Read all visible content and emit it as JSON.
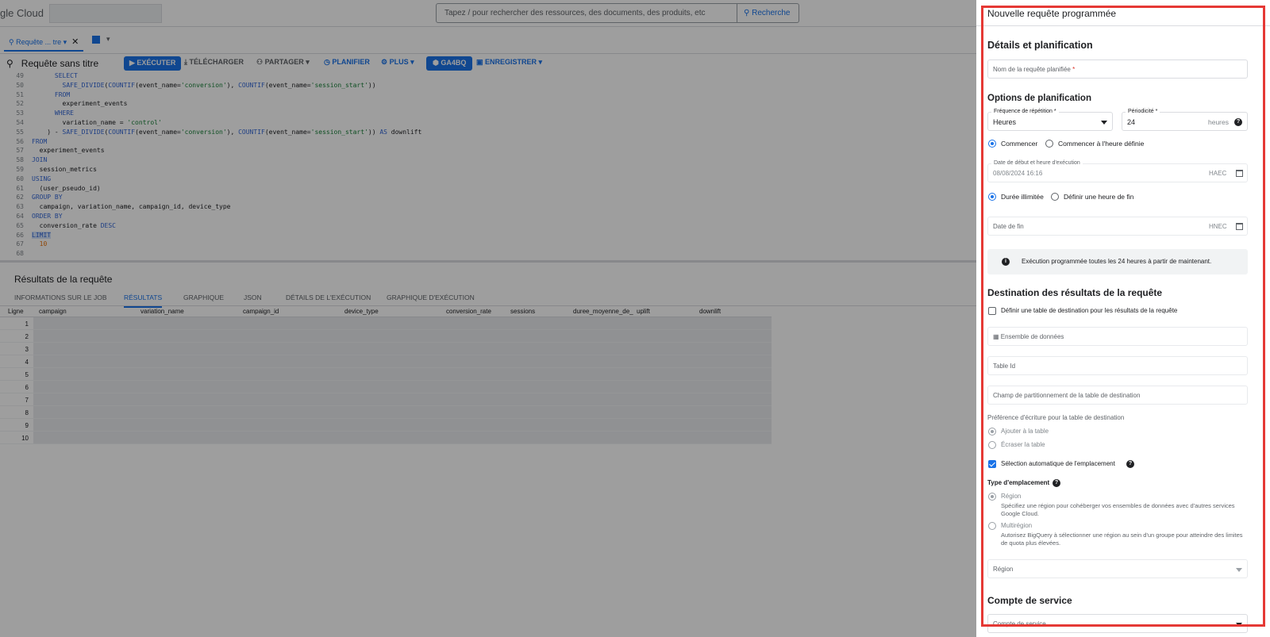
{
  "app": {
    "logo": "gle Cloud"
  },
  "search": {
    "placeholder": "Tapez / pour rechercher des ressources, des documents, des produits, etc",
    "button": "Recherche"
  },
  "editor_tab": {
    "label": "Requête ... tre"
  },
  "toolbar": {
    "title": "Requête sans titre",
    "run": "EXÉCUTER",
    "download": "TÉLÉCHARGER",
    "share": "PARTAGER",
    "schedule": "PLANIFIER",
    "more": "PLUS",
    "ga4": "GA4BQ",
    "save": "ENREGISTRER"
  },
  "code": [
    {
      "n": "49",
      "parts": [
        {
          "t": "      "
        },
        {
          "t": "SELECT",
          "c": "kw"
        }
      ]
    },
    {
      "n": "50",
      "parts": [
        {
          "t": "        "
        },
        {
          "t": "SAFE_DIVIDE",
          "c": "kw"
        },
        {
          "t": "("
        },
        {
          "t": "COUNTIF",
          "c": "kw"
        },
        {
          "t": "(event_name="
        },
        {
          "t": "'conversion'",
          "c": "str"
        },
        {
          "t": "), "
        },
        {
          "t": "COUNTIF",
          "c": "kw"
        },
        {
          "t": "(event_name="
        },
        {
          "t": "'session_start'",
          "c": "str"
        },
        {
          "t": "))"
        }
      ]
    },
    {
      "n": "51",
      "parts": [
        {
          "t": "      "
        },
        {
          "t": "FROM",
          "c": "kw"
        }
      ]
    },
    {
      "n": "52",
      "parts": [
        {
          "t": "        experiment_events"
        }
      ]
    },
    {
      "n": "53",
      "parts": [
        {
          "t": "      "
        },
        {
          "t": "WHERE",
          "c": "kw"
        }
      ]
    },
    {
      "n": "54",
      "parts": [
        {
          "t": "        variation_name = "
        },
        {
          "t": "'control'",
          "c": "str"
        }
      ]
    },
    {
      "n": "55",
      "parts": [
        {
          "t": "    ) - "
        },
        {
          "t": "SAFE_DIVIDE",
          "c": "kw"
        },
        {
          "t": "("
        },
        {
          "t": "COUNTIF",
          "c": "kw"
        },
        {
          "t": "(event_name="
        },
        {
          "t": "'conversion'",
          "c": "str"
        },
        {
          "t": "), "
        },
        {
          "t": "COUNTIF",
          "c": "kw"
        },
        {
          "t": "(event_name="
        },
        {
          "t": "'session_start'",
          "c": "str"
        },
        {
          "t": ")) "
        },
        {
          "t": "AS",
          "c": "kw"
        },
        {
          "t": " downlift"
        }
      ]
    },
    {
      "n": "56",
      "parts": [
        {
          "t": "FROM",
          "c": "kw"
        }
      ]
    },
    {
      "n": "57",
      "parts": [
        {
          "t": "  experiment_events"
        }
      ]
    },
    {
      "n": "58",
      "parts": [
        {
          "t": "JOIN",
          "c": "kw"
        }
      ]
    },
    {
      "n": "59",
      "parts": [
        {
          "t": "  session_metrics"
        }
      ]
    },
    {
      "n": "60",
      "parts": [
        {
          "t": "USING",
          "c": "kw"
        }
      ]
    },
    {
      "n": "61",
      "parts": [
        {
          "t": "  (user_pseudo_id)"
        }
      ]
    },
    {
      "n": "62",
      "parts": [
        {
          "t": "GROUP BY",
          "c": "kw"
        }
      ]
    },
    {
      "n": "63",
      "parts": [
        {
          "t": "  campaign, variation_name, campaign_id, device_type"
        }
      ]
    },
    {
      "n": "64",
      "parts": [
        {
          "t": "ORDER BY",
          "c": "kw"
        }
      ]
    },
    {
      "n": "65",
      "parts": [
        {
          "t": "  conversion_rate "
        },
        {
          "t": "DESC",
          "c": "kw"
        }
      ]
    },
    {
      "n": "66",
      "parts": [
        {
          "t": "LIMIT",
          "c": "kw hl"
        }
      ]
    },
    {
      "n": "67",
      "parts": [
        {
          "t": "  "
        },
        {
          "t": "10",
          "c": "num"
        }
      ]
    },
    {
      "n": "68",
      "parts": [
        {
          "t": ""
        }
      ]
    }
  ],
  "results": {
    "title": "Résultats de la requête",
    "tabs": [
      "INFORMATIONS SUR LE JOB",
      "RÉSULTATS",
      "GRAPHIQUE",
      "JSON",
      "DÉTAILS DE L'EXÉCUTION",
      "GRAPHIQUE D'EXÉCUTION"
    ],
    "active_tab": "RÉSULTATS",
    "columns": [
      "Ligne",
      "campaign",
      "variation_name",
      "campaign_id",
      "device_type",
      "conversion_rate",
      "sessions",
      "duree_moyenne_de_",
      "uplift",
      "downlift"
    ],
    "rows": [
      "1",
      "2",
      "3",
      "4",
      "5",
      "6",
      "7",
      "8",
      "9",
      "10"
    ]
  },
  "panel": {
    "title": "Nouvelle requête programmée",
    "section_details": "Détails et planification",
    "name_placeholder": "Nom de la requête planifiée",
    "name_required": "*",
    "section_options": "Options de planification",
    "freq_label": "Fréquence de répétition *",
    "freq_value": "Heures",
    "period_label": "Périodicité *",
    "period_value": "24",
    "period_unit": "heures",
    "start_now": "Commencer",
    "start_at": "Commencer à l'heure définie",
    "start_date_label": "Date de début et heure d'exécution",
    "start_date_value": "08/08/2024 16:16",
    "start_tz": "HAEC",
    "unlimited": "Durée illimitée",
    "set_end": "Définir une heure de fin",
    "end_date": "Date de fin",
    "end_tz": "HNEC",
    "info": "Exécution programmée toutes les 24 heures à partir de maintenant.",
    "section_dest": "Destination des résultats de la requête",
    "dest_checkbox": "Définir une table de destination pour les résultats de la requête",
    "dataset": "Ensemble de données",
    "table_id": "Table Id",
    "partition": "Champ de partitionnement de la table de destination",
    "write_pref": "Préférence d'écriture pour la table de destination",
    "append": "Ajouter à la table",
    "overwrite": "Écraser la table",
    "auto_location": "Sélection automatique de l'emplacement",
    "location_type": "Type d'emplacement",
    "region": "Région",
    "region_desc": "Spécifiez une région pour cohéberger vos ensembles de données avec d'autres services Google Cloud.",
    "multiregion": "Multirégion",
    "multiregion_desc": "Autorisez BigQuery à sélectionner une région au sein d'un groupe pour atteindre des limites de quota plus élevées.",
    "region_select": "Région",
    "section_sa": "Compte de service",
    "sa_field": "Compte de service"
  },
  "colors": {
    "accent": "#1a73e8",
    "highlight_frame": "#e53935"
  }
}
